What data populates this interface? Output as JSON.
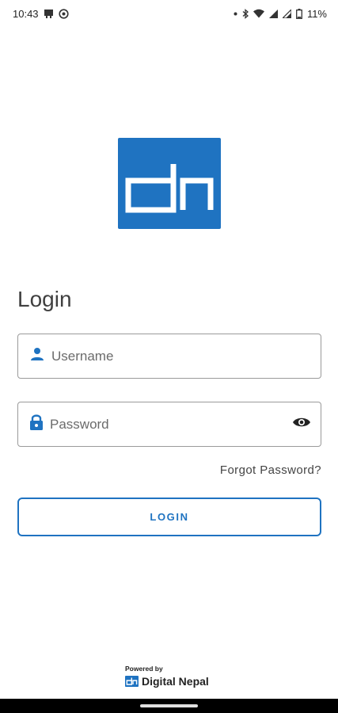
{
  "status_bar": {
    "time": "10:43",
    "battery": "11%",
    "icons": [
      "notification-icon",
      "vpn-icon",
      "bluetooth-icon",
      "wifi-icon",
      "signal-icon",
      "signal-icon-2",
      "battery-icon"
    ]
  },
  "brand": {
    "logo": "dn",
    "color": "#1f73c1"
  },
  "login": {
    "title": "Login",
    "username_placeholder": "Username",
    "password_placeholder": "Password",
    "forgot_label": "Forgot Password?",
    "button_label": "LOGIN"
  },
  "footer": {
    "powered_by": "Powered by",
    "brand_name": "Digital Nepal"
  }
}
